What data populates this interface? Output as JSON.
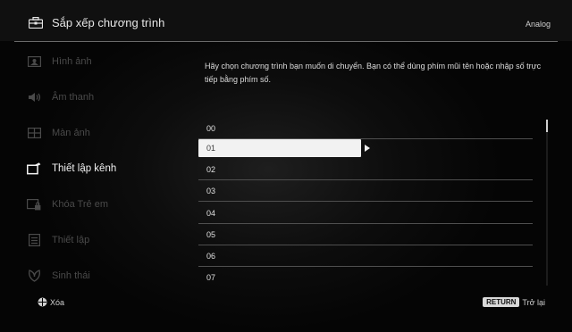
{
  "header": {
    "title": "Sắp xếp chương trình",
    "source": "Analog"
  },
  "sidebar": {
    "items": [
      {
        "label": "Hình ảnh",
        "icon": "picture-icon",
        "active": false
      },
      {
        "label": "Âm thanh",
        "icon": "speaker-icon",
        "active": false
      },
      {
        "label": "Màn ảnh",
        "icon": "screen-icon",
        "active": false
      },
      {
        "label": "Thiết lập kênh",
        "icon": "channel-setup-icon",
        "active": true
      },
      {
        "label": "Khóa Trẻ em",
        "icon": "parental-lock-icon",
        "active": false
      },
      {
        "label": "Thiết lập",
        "icon": "settings-icon",
        "active": false
      },
      {
        "label": "Sinh thái",
        "icon": "eco-leaf-icon",
        "active": false
      }
    ]
  },
  "panel": {
    "description": "Hãy chọn chương trình bạn muốn di chuyển. Bạn có thể dùng phím mũi tên hoặc nhập số trực tiếp bằng phím số.",
    "programs": [
      "00",
      "01",
      "02",
      "03",
      "04",
      "05",
      "06",
      "07"
    ],
    "selected_index": 1
  },
  "footer": {
    "delete_label": "Xóa",
    "return_key": "RETURN",
    "back_label": "Trở lại"
  },
  "colors": {
    "background": "#000000",
    "header_bg": "#101010",
    "selected_bg": "#f2f2f2",
    "inactive_text": "#4a4a4a",
    "active_text": "#f2f2f2"
  }
}
